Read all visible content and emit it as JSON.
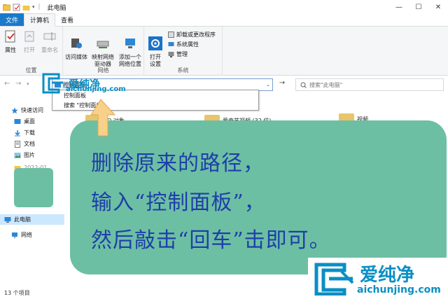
{
  "window": {
    "title": "此电脑",
    "controls": {
      "minimize": "—",
      "maximize": "☐",
      "close": "✕"
    }
  },
  "ribbon": {
    "tabs": [
      {
        "label": "文件"
      },
      {
        "label": "计算机"
      },
      {
        "label": "查看"
      }
    ],
    "groups": {
      "location": {
        "label": "位置",
        "buttons": [
          {
            "label": "属性",
            "icon": "properties-icon"
          },
          {
            "label": "打开",
            "icon": "open-icon"
          },
          {
            "label": "重命名",
            "icon": "rename-icon"
          }
        ]
      },
      "network": {
        "label": "网络",
        "buttons": [
          {
            "label": "访问媒体",
            "icon": "media-icon"
          },
          {
            "label": "映射网络\n驱动器",
            "icon": "map-drive-icon"
          },
          {
            "label": "添加一个\n网络位置",
            "icon": "add-network-location-icon"
          }
        ]
      },
      "system": {
        "label": "系统",
        "big_button": {
          "label": "打开\n设置",
          "icon": "settings-gear-icon"
        },
        "small_buttons": [
          {
            "label": "卸载或更改程序",
            "icon": "uninstall-icon"
          },
          {
            "label": "系统属性",
            "icon": "system-properties-icon"
          },
          {
            "label": "管理",
            "icon": "manage-icon"
          }
        ]
      }
    }
  },
  "navigation": {
    "address_value": "控制面板",
    "search_placeholder": "搜索\"此电脑\"",
    "autocomplete": [
      "控制面板",
      "搜索 \"控制面板\""
    ]
  },
  "sidebar": {
    "items": [
      {
        "label": "快速访问",
        "icon": "star-icon"
      },
      {
        "label": "桌面",
        "icon": "desktop-icon"
      },
      {
        "label": "下载",
        "icon": "download-icon"
      },
      {
        "label": "文档",
        "icon": "documents-icon"
      },
      {
        "label": "图片",
        "icon": "pictures-icon"
      },
      {
        "label": "2022-01",
        "icon": "folder-icon"
      },
      {
        "label": "此电脑",
        "icon": "computer-icon"
      },
      {
        "label": "网络",
        "icon": "network-icon"
      }
    ]
  },
  "main": {
    "folders": [
      {
        "label": "3D 对象"
      },
      {
        "label": "爱奇艺视频 (32 位)"
      },
      {
        "label": "视频"
      }
    ]
  },
  "status": {
    "item_count": "13 个项目"
  },
  "annotation": {
    "lines": [
      "删除原来的路径，",
      "输入“控制面板”，",
      "然后敲击“回车”击即可。"
    ]
  },
  "watermark": {
    "cn": "爱纯净",
    "en": "aichunjing.com"
  },
  "colors": {
    "accent": "#1979ca",
    "callout": "#6dbfa3",
    "callout_text": "#1d3fa8",
    "watermark": "#0a8fc4"
  }
}
